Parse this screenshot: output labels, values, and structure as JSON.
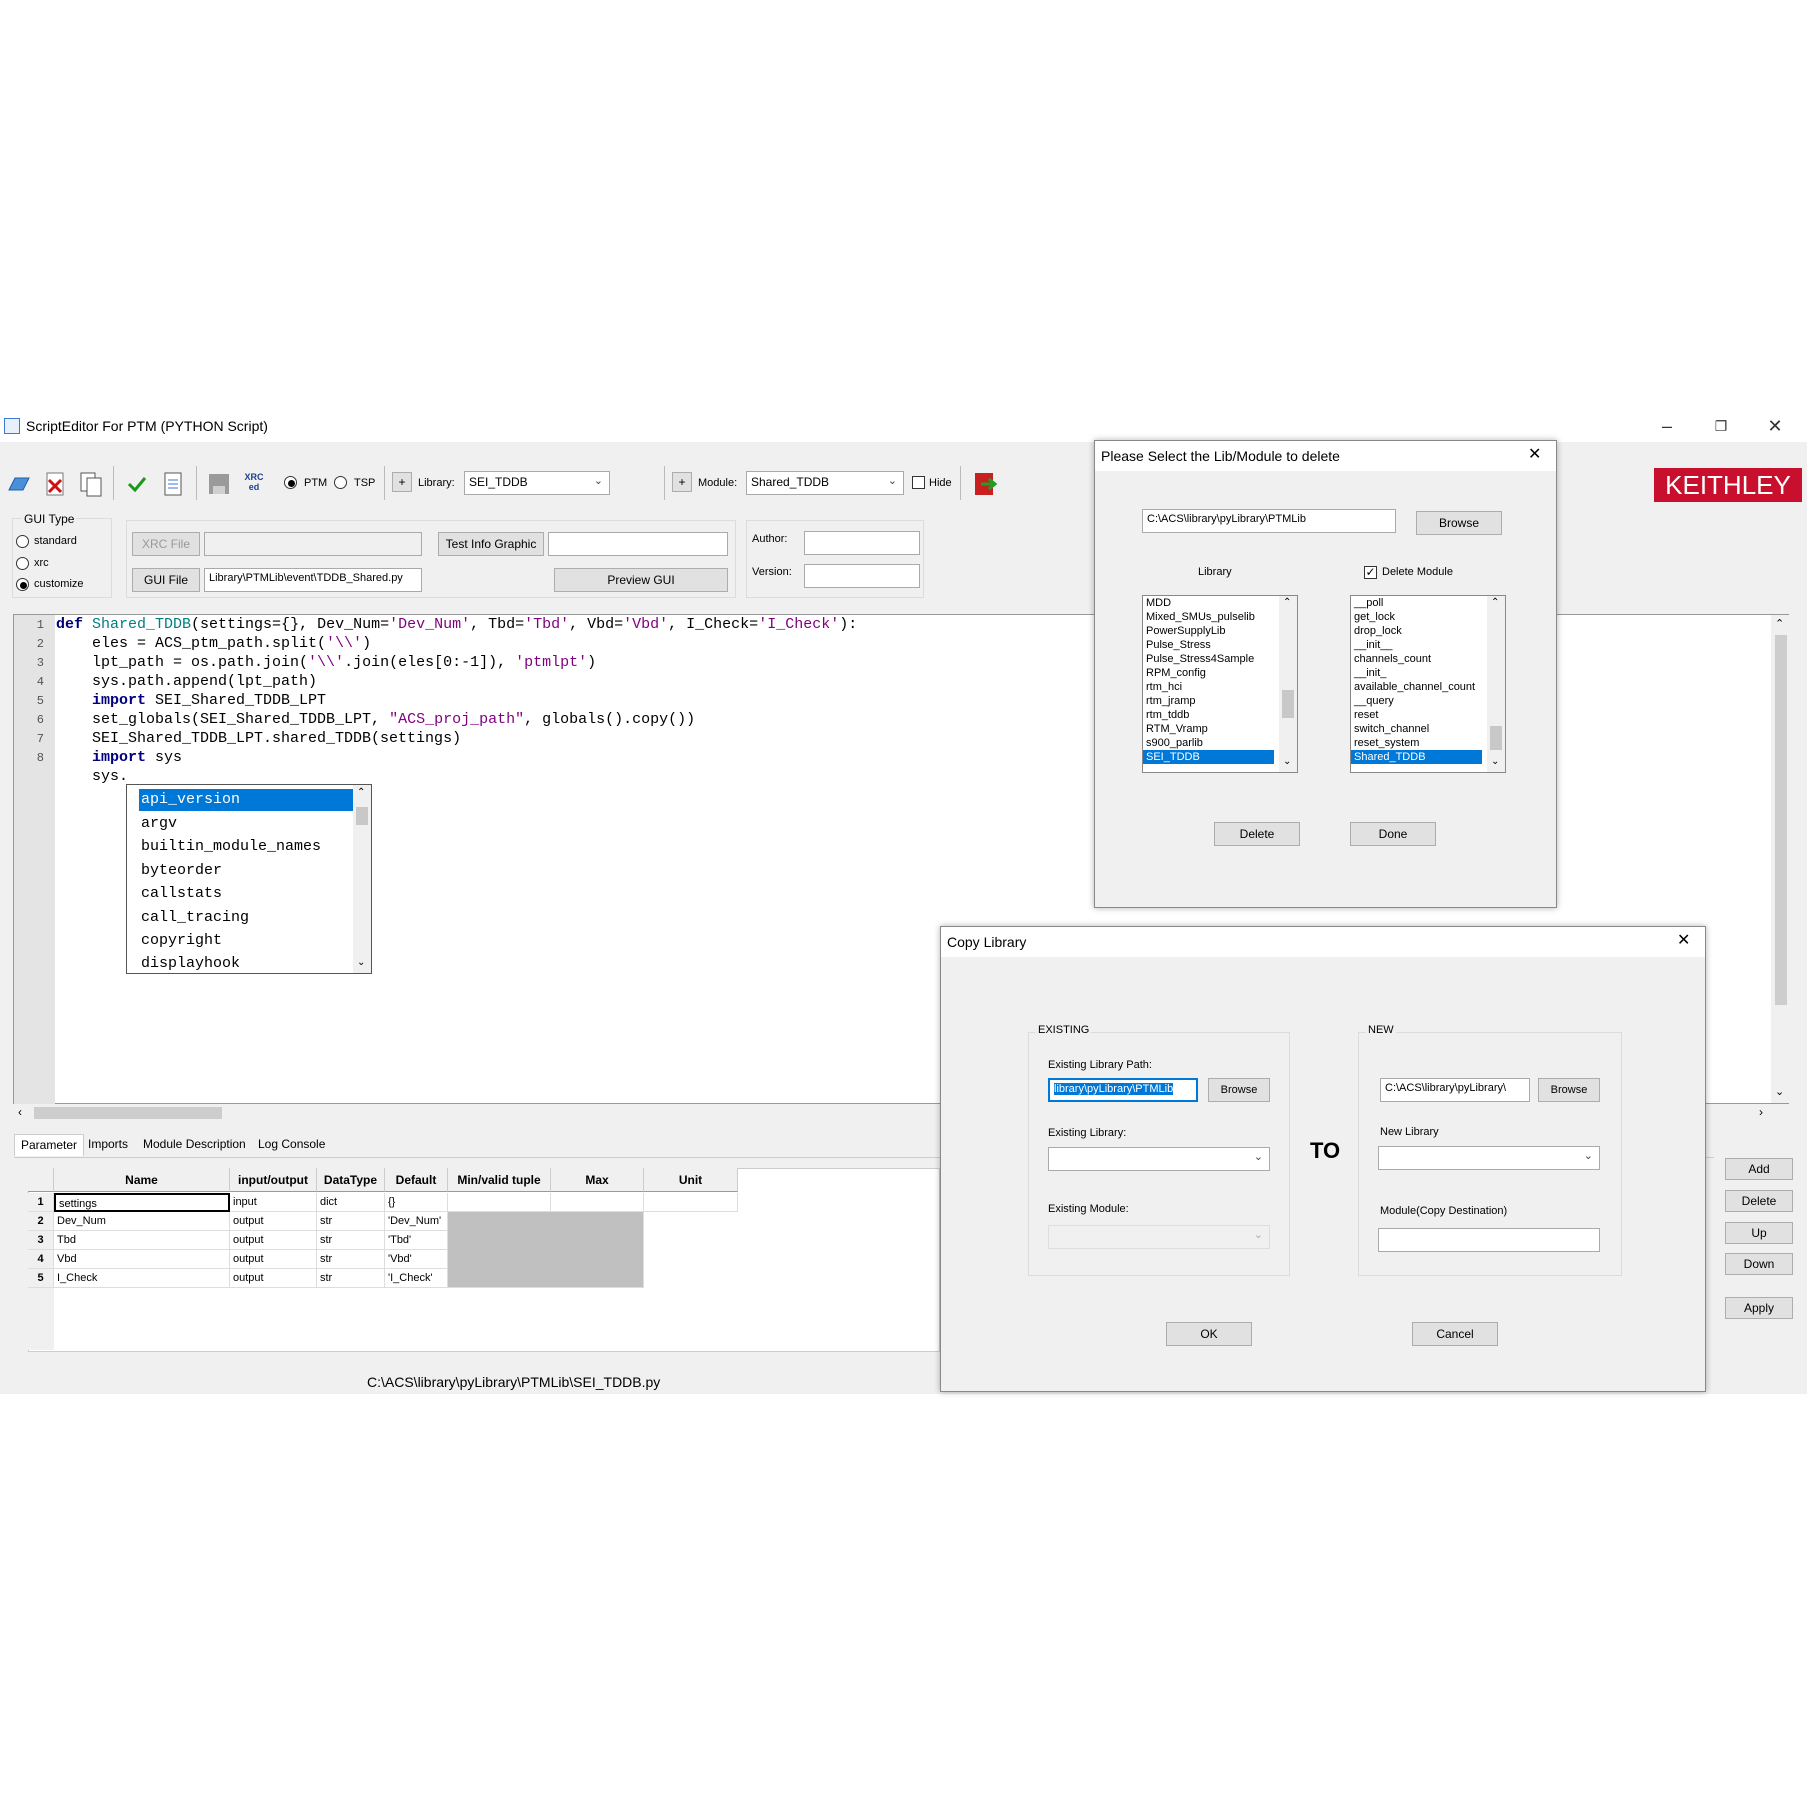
{
  "app": {
    "title": "ScriptEditor For PTM (PYTHON Script)"
  },
  "toolbar": {
    "xrc_label": "XRC ed",
    "ptm_label": "PTM",
    "tsp_label": "TSP",
    "plus": "+",
    "library_label": "Library:",
    "library_value": "SEI_TDDB",
    "module_label": "Module:",
    "module_value": "Shared_TDDB",
    "hide_label": "Hide",
    "brand": "KEITHLEY"
  },
  "gui_type": {
    "title": "GUI Type",
    "options": [
      "standard",
      "xrc",
      "customize"
    ],
    "selected": "customize",
    "xrc_file_button": "XRC File",
    "gui_file_button": "GUI File",
    "gui_file_value": "Library\\PTMLib\\event\\TDDB_Shared.py",
    "test_info_button": "Test Info Graphic",
    "preview_button": "Preview  GUI",
    "author_label": "Author:",
    "version_label": "Version:"
  },
  "editor": {
    "line_numbers": [
      "1",
      "2",
      "3",
      "4",
      "5",
      "6",
      "7",
      "8"
    ],
    "lines": [
      {
        "a_kw": "def ",
        "b_fn": "Shared_TDDB",
        "c": "(settings={}, Dev_Num=",
        "d_str": "'Dev_Num'",
        "e": ", Tbd=",
        "f_str": "'Tbd'",
        "g": ", Vbd=",
        "h_str": "'Vbd'",
        "i": ", I_Check=",
        "j_str": "'I_Check'",
        "k": "):"
      },
      {
        "pre": "    eles = ACS_ptm_path.split(",
        "s": "'\\\\'",
        "post": ")"
      },
      {
        "pre": "    lpt_path = os.path.join(",
        "s": "'\\\\'",
        "post": ".join(eles[0:-1]), ",
        "s2": "'ptmlpt'",
        "post2": ")"
      },
      {
        "pre": "    sys.path.append(lpt_path)"
      },
      {
        "kw": "import",
        "post": " SEI_Shared_TDDB_LPT"
      },
      {
        "pre": "    set_globals(SEI_Shared_TDDB_LPT, ",
        "s": "\"ACS_proj_path\"",
        "post": ", globals().copy())"
      },
      {
        "pre": "    SEI_Shared_TDDB_LPT.shared_TDDB(settings)"
      },
      {
        "kw": "import",
        "post": " sys"
      },
      {
        "pre": "    sys."
      }
    ],
    "autocomplete": [
      "api_version",
      "argv",
      "builtin_module_names",
      "byteorder",
      "callstats",
      "call_tracing",
      "copyright",
      "displayhook"
    ]
  },
  "bottom_tabs": [
    "Parameter",
    "Imports",
    "Module Description",
    "Log Console"
  ],
  "param_table": {
    "headers": [
      "Name",
      "input/output",
      "DataType",
      "Default",
      "Min/valid tuple",
      "Max",
      "Unit"
    ],
    "rows": [
      {
        "n": "1",
        "name": "settings",
        "io": "input",
        "type": "dict",
        "def": "{}"
      },
      {
        "n": "2",
        "name": "Dev_Num",
        "io": "output",
        "type": "str",
        "def": "'Dev_Num'"
      },
      {
        "n": "3",
        "name": "Tbd",
        "io": "output",
        "type": "str",
        "def": "'Tbd'"
      },
      {
        "n": "4",
        "name": "Vbd",
        "io": "output",
        "type": "str",
        "def": "'Vbd'"
      },
      {
        "n": "5",
        "name": "I_Check",
        "io": "output",
        "type": "str",
        "def": "'I_Check'"
      }
    ]
  },
  "right_buttons": [
    "Add",
    "Delete",
    "Up",
    "Down",
    "Apply"
  ],
  "status": {
    "path": "C:\\ACS\\library\\pyLibrary\\PTMLib\\SEI_TDDB.py"
  },
  "delete_dialog": {
    "title": "Please Select the Lib/Module to delete",
    "path": "C:\\ACS\\library\\pyLibrary\\PTMLib",
    "browse": "Browse",
    "library_label": "Library",
    "delete_module_label": "Delete Module",
    "libraries": [
      "MDD",
      "Mixed_SMUs_pulselib",
      "PowerSupplyLib",
      "Pulse_Stress",
      "Pulse_Stress4Sample",
      "RPM_config",
      "rtm_hci",
      "rtm_jramp",
      "rtm_tddb",
      "RTM_Vramp",
      "s900_parlib",
      "SEI_TDDB"
    ],
    "selected_library": "SEI_TDDB",
    "modules": [
      "__poll",
      "get_lock",
      "drop_lock",
      "__init__",
      "channels_count",
      "__init_",
      "available_channel_count",
      "__query",
      "reset",
      "switch_channel",
      "reset_system",
      "Shared_TDDB"
    ],
    "selected_module": "Shared_TDDB",
    "delete_button": "Delete",
    "done_button": "Done"
  },
  "copy_dialog": {
    "title": "Copy Library",
    "existing_group": "EXISTING",
    "new_group": "NEW",
    "existing_path_label": "Existing Library Path:",
    "existing_path_value": "library\\pyLibrary\\PTMLib",
    "browse": "Browse",
    "existing_library_label": "Existing Library:",
    "existing_module_label": "Existing Module:",
    "to_label": "TO",
    "new_path_value": "C:\\ACS\\library\\pyLibrary\\",
    "new_library_label": "New Library",
    "module_dest_label": "Module(Copy Destination)",
    "ok": "OK",
    "cancel": "Cancel"
  },
  "colors": {
    "selection": "#0078d7",
    "brand_red": "#c8102e",
    "keyword": "#00007f",
    "string": "#7f007f"
  }
}
